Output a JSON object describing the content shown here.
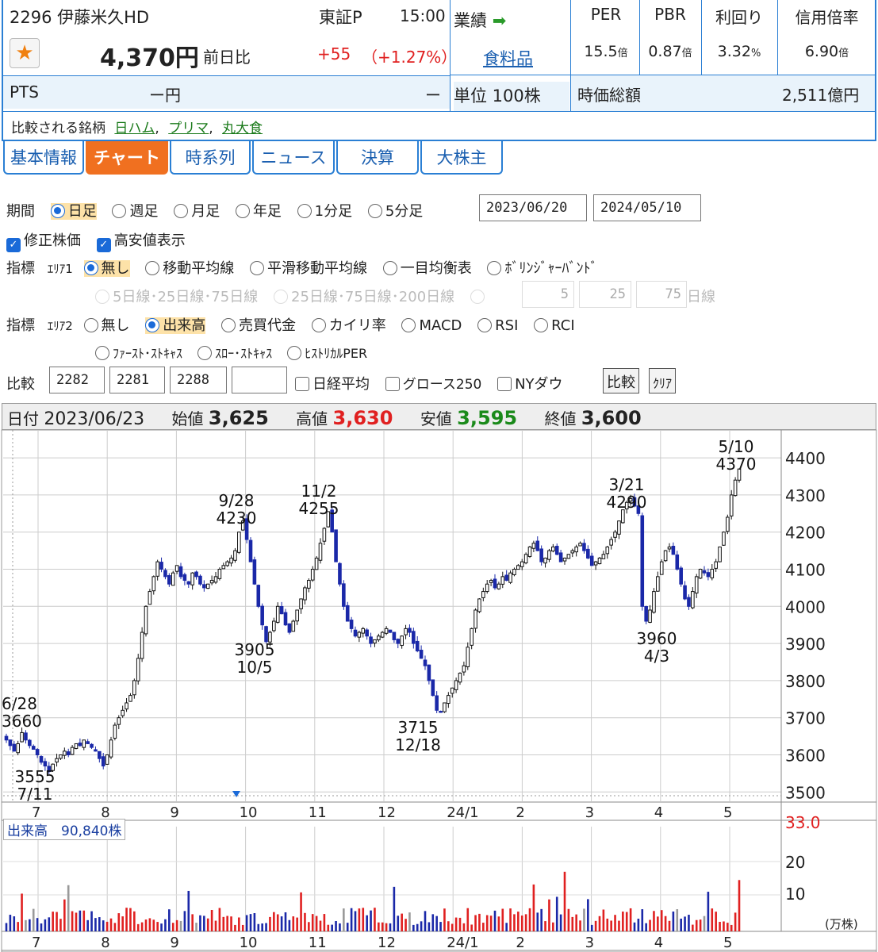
{
  "stock": {
    "code_name": "2296 伊藤米久HD",
    "market": "東証P",
    "time": "15:00",
    "price": "4,370円",
    "prev_label": "前日比",
    "change": "+55",
    "change_pct": "（+1.27%）",
    "pts_label": "PTS",
    "pts_value": "ー円",
    "pts_change": "ー",
    "gyoseki": "業績",
    "sector": "食料品",
    "unit": "単位 100株",
    "compare_label": "比較される銘柄",
    "compare": [
      "日ハム",
      "プリマ",
      "丸大食"
    ]
  },
  "metrics": {
    "headers": [
      "PER",
      "PBR",
      "利回り",
      "信用倍率"
    ],
    "values": [
      [
        "15.5",
        "倍"
      ],
      [
        "0.87",
        "倍"
      ],
      [
        "3.32",
        "%"
      ],
      [
        "6.90",
        "倍"
      ]
    ],
    "mcap_label": "時価総額",
    "mcap_value": "2,511億円"
  },
  "tabs": [
    "基本情報",
    "チャート",
    "時系列",
    "ニュース",
    "決算",
    "大株主"
  ],
  "controls": {
    "period_label": "期間",
    "periods": [
      "日足",
      "週足",
      "月足",
      "年足",
      "1分足",
      "5分足"
    ],
    "date_from": "2023/06/20",
    "date_to": "2024/05/10",
    "adjusted": "修正株価",
    "high_low": "高安値表示",
    "ind_label": "指標",
    "area1": "ｴﾘｱ1",
    "area1_opts": [
      "無し",
      "移動平均線",
      "平滑移動平均線",
      "一目均衡表",
      "ﾎﾞﾘﾝｼﾞｬｰﾊﾞﾝﾄﾞ"
    ],
    "ma_opts": [
      "5日線･25日線･75日線",
      "25日線･75日線･200日線"
    ],
    "ma_vals": [
      "5",
      "25",
      "75"
    ],
    "ma_unit": "日線",
    "area2": "ｴﾘｱ2",
    "area2_opts": [
      "無し",
      "出来高",
      "売買代金",
      "カイリ率",
      "MACD",
      "RSI",
      "RCI"
    ],
    "area2_opts2": [
      "ﾌｧｰｽﾄ･ｽﾄｷｬｽ",
      "ｽﾛｰ･ｽﾄｷｬｽ",
      "ﾋｽﾄﾘｶﾙPER"
    ],
    "cmp_label": "比較",
    "cmp_codes": [
      "2282",
      "2281",
      "2288",
      ""
    ],
    "cmp_idx": [
      "日経平均",
      "グロース250",
      "NYダウ"
    ],
    "cmp_btn": "比較",
    "clear_btn": "ｸﾘｱ"
  },
  "ohlc_header": {
    "date_label": "日付",
    "date": "2023/06/23",
    "open_label": "始値",
    "open": "3,625",
    "high_label": "高値",
    "high": "3,630",
    "low_label": "安値",
    "low": "3,595",
    "close_label": "終値",
    "close": "3,600"
  },
  "volume": {
    "label": "出来高",
    "value": "90,840株",
    "unit": "(万株)",
    "ticks": [
      "33.0",
      "20",
      "10"
    ]
  },
  "chart_data": {
    "type": "candlestick",
    "x_ticks": [
      "7",
      "8",
      "9",
      "10",
      "11",
      "12",
      "24/1",
      "2",
      "3",
      "4",
      "5"
    ],
    "y_ticks": [
      4400,
      4300,
      4200,
      4100,
      4000,
      3900,
      3800,
      3700,
      3600,
      3500
    ],
    "ylim": [
      3475,
      4475
    ],
    "annotations": [
      {
        "date": "6/28",
        "value": "3660"
      },
      {
        "date": "7/11",
        "value": "3555"
      },
      {
        "date": "9/28",
        "value": "4230"
      },
      {
        "date": "10/5",
        "value": "3905"
      },
      {
        "date": "11/2",
        "value": "4255"
      },
      {
        "date": "12/18",
        "value": "3715"
      },
      {
        "date": "3/21",
        "value": "4290"
      },
      {
        "date": "4/3",
        "value": "3960"
      },
      {
        "date": "5/10",
        "value": "4370"
      }
    ],
    "closes": [
      3640,
      3625,
      3610,
      3630,
      3660,
      3640,
      3625,
      3615,
      3600,
      3580,
      3570,
      3555,
      3575,
      3590,
      3600,
      3610,
      3600,
      3620,
      3630,
      3625,
      3640,
      3630,
      3620,
      3610,
      3590,
      3570,
      3600,
      3640,
      3680,
      3700,
      3720,
      3740,
      3760,
      3800,
      3860,
      3930,
      4000,
      4040,
      4080,
      4120,
      4100,
      4080,
      4060,
      4090,
      4110,
      4080,
      4070,
      4060,
      4090,
      4080,
      4060,
      4050,
      4060,
      4070,
      4080,
      4100,
      4110,
      4120,
      4130,
      4150,
      4200,
      4230,
      4180,
      4120,
      4060,
      4000,
      3950,
      3905,
      3930,
      3960,
      4000,
      3980,
      3950,
      3930,
      3960,
      3990,
      4020,
      4050,
      4070,
      4100,
      4130,
      4170,
      4210,
      4255,
      4200,
      4120,
      4060,
      4000,
      3960,
      3940,
      3920,
      3930,
      3940,
      3920,
      3900,
      3910,
      3920,
      3930,
      3940,
      3930,
      3910,
      3900,
      3920,
      3940,
      3930,
      3900,
      3880,
      3860,
      3840,
      3800,
      3760,
      3720,
      3715,
      3740,
      3760,
      3780,
      3800,
      3820,
      3840,
      3890,
      3940,
      3990,
      4020,
      4040,
      4060,
      4070,
      4050,
      4060,
      4080,
      4070,
      4090,
      4100,
      4110,
      4120,
      4140,
      4160,
      4170,
      4150,
      4120,
      4130,
      4150,
      4160,
      4140,
      4120,
      4130,
      4140,
      4150,
      4160,
      4170,
      4150,
      4130,
      4110,
      4120,
      4130,
      4140,
      4160,
      4180,
      4200,
      4230,
      4260,
      4280,
      4290,
      4270,
      4250,
      4000,
      3960,
      3990,
      4040,
      4080,
      4120,
      4150,
      4160,
      4140,
      4100,
      4060,
      4020,
      4000,
      4040,
      4080,
      4100,
      4090,
      4080,
      4100,
      4120,
      4160,
      4200,
      4240,
      4300,
      4340,
      4370
    ]
  }
}
